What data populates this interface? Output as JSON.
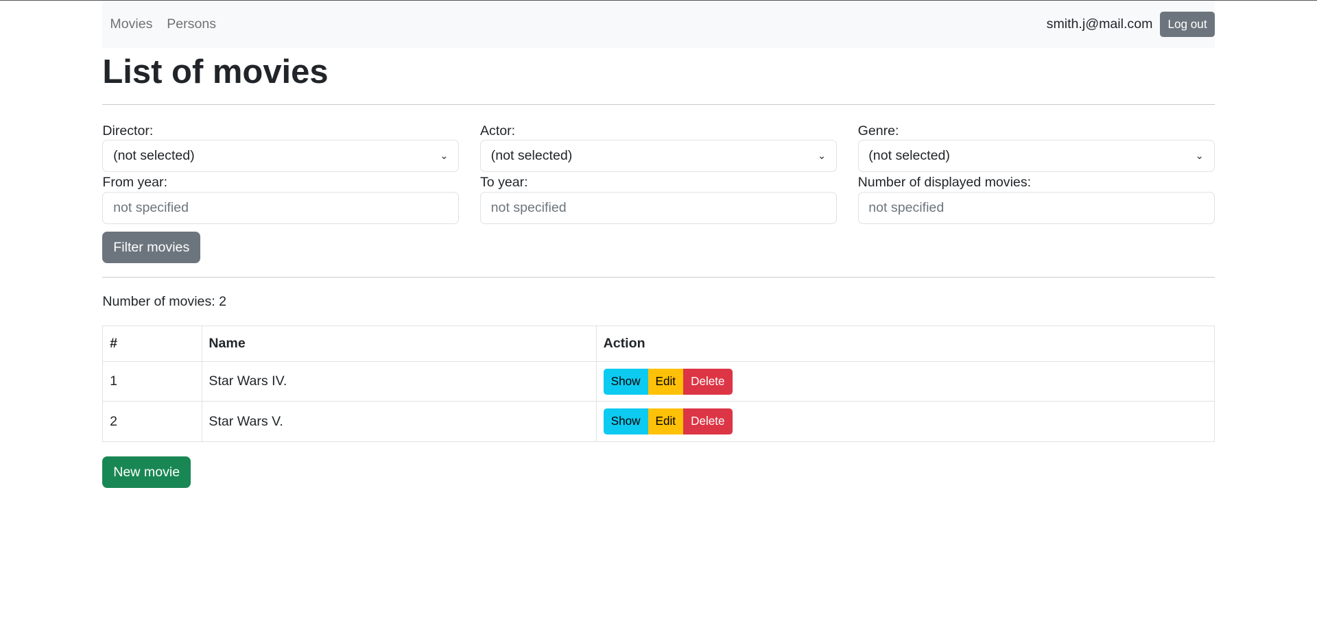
{
  "nav": {
    "links": [
      "Movies",
      "Persons"
    ],
    "user_email": "smith.j@mail.com",
    "logout": "Log out"
  },
  "title": "List of movies",
  "filters": {
    "director": {
      "label": "Director:",
      "value": "(not selected)"
    },
    "actor": {
      "label": "Actor:",
      "value": "(not selected)"
    },
    "genre": {
      "label": "Genre:",
      "value": "(not selected)"
    },
    "from_year": {
      "label": "From year:",
      "placeholder": "not specified"
    },
    "to_year": {
      "label": "To year:",
      "placeholder": "not specified"
    },
    "limit": {
      "label": "Number of displayed movies:",
      "placeholder": "not specified"
    },
    "submit": "Filter movies"
  },
  "count_text": "Number of movies: 2",
  "table": {
    "headers": [
      "#",
      "Name",
      "Action"
    ],
    "rows": [
      {
        "num": "1",
        "name": "Star Wars IV."
      },
      {
        "num": "2",
        "name": "Star Wars V."
      }
    ],
    "actions": {
      "show": "Show",
      "edit": "Edit",
      "delete": "Delete"
    }
  },
  "new_movie": "New movie"
}
